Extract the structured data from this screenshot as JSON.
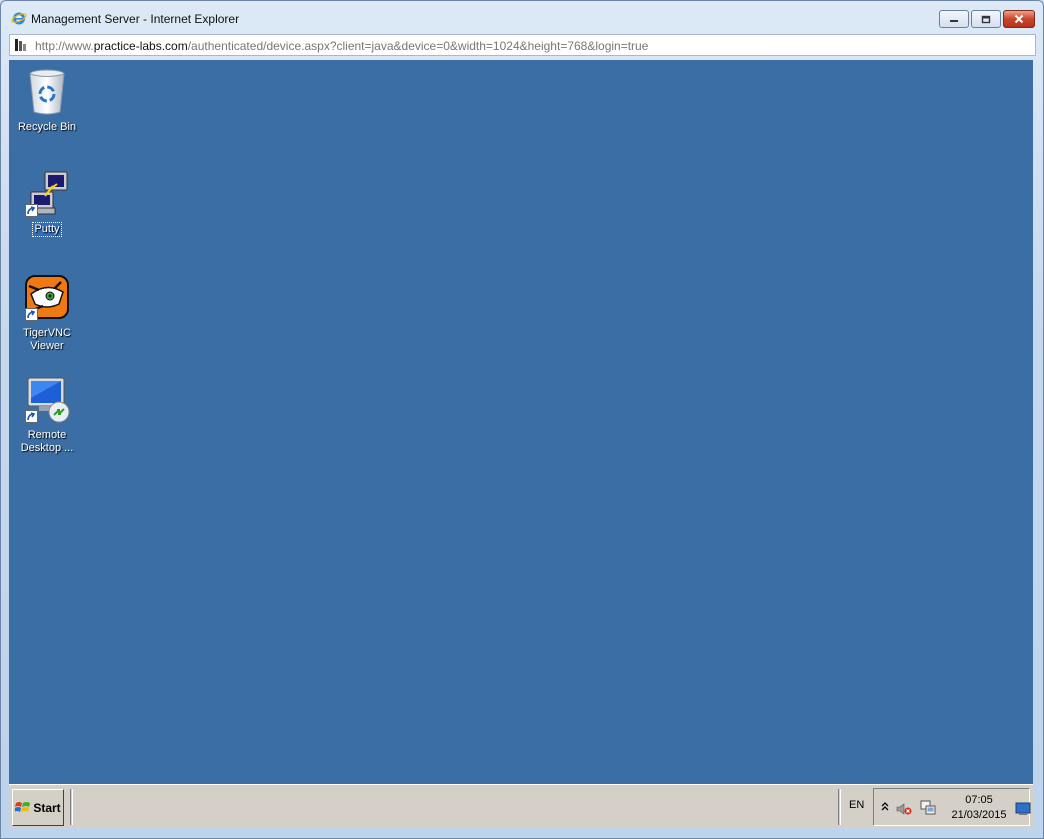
{
  "window": {
    "title": "Management Server - Internet Explorer",
    "address": {
      "prefix": "http://www.",
      "domain": "practice-labs.com",
      "path": "/authenticated/device.aspx?client=java&device=0&width=1024&height=768&login=true"
    }
  },
  "desktop": {
    "background": "#3a6ea5",
    "icons": [
      {
        "label": "Recycle Bin",
        "icon": "recycle-bin-icon",
        "selected": false
      },
      {
        "label": "Putty",
        "icon": "putty-icon",
        "selected": true
      },
      {
        "label": "TigerVNC\nViewer",
        "icon": "tigervnc-icon",
        "selected": false
      },
      {
        "label": "Remote\nDesktop ...",
        "icon": "remote-desktop-icon",
        "selected": false
      }
    ]
  },
  "taskbar": {
    "start_label": "Start",
    "language": "EN",
    "clock_time": "07:05",
    "clock_date": "21/03/2015"
  }
}
